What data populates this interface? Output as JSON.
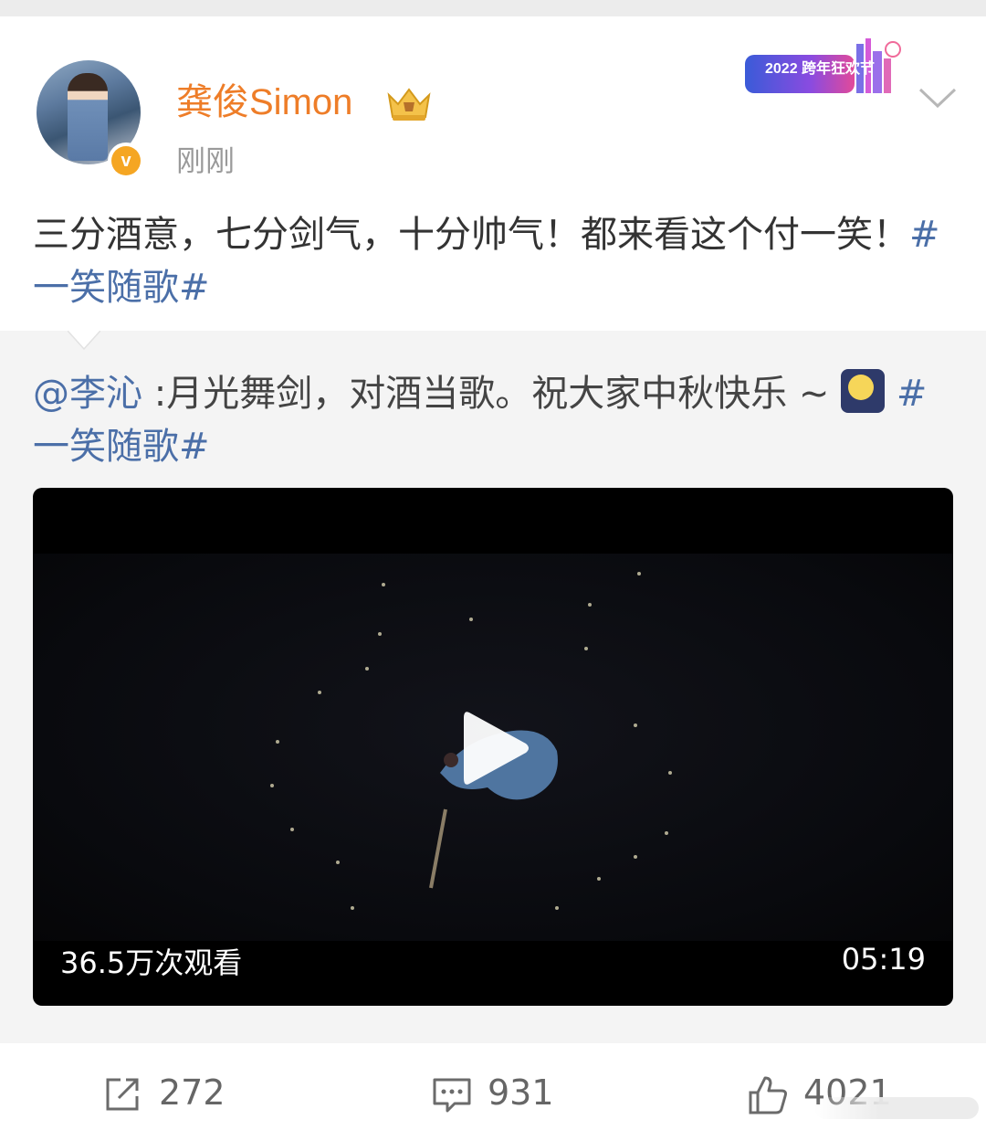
{
  "post": {
    "username": "龚俊Simon",
    "timestamp": "刚刚",
    "text_before": "三分酒意，七分剑气，十分帅气！都来看这个付一笑！",
    "hashtag": "#一笑随歌#",
    "event_banner": "2022 跨年狂欢节"
  },
  "repost": {
    "mention": "@李沁",
    "text": " :月光舞剑，对酒当歌。祝大家中秋快乐 ~ ",
    "hashtag": "#一笑随歌#"
  },
  "video": {
    "view_count": "36.5万次观看",
    "duration": "05:19"
  },
  "actions": {
    "repost_count": "272",
    "comment_count": "931",
    "like_count": "4021"
  },
  "colors": {
    "username": "#ee7d28",
    "link": "#4b6fa8",
    "verified": "#f5a623"
  },
  "icons": [
    "crown-icon",
    "chevron-down-icon",
    "moon-icon",
    "play-icon",
    "share-icon",
    "comment-icon",
    "thumbs-up-icon"
  ]
}
